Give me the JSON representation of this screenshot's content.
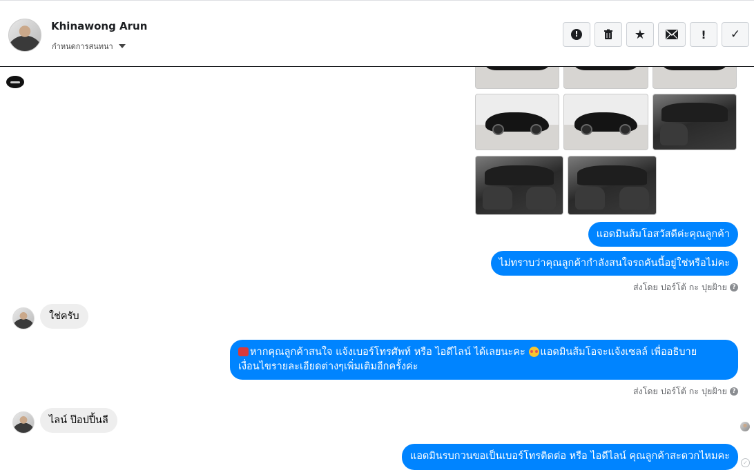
{
  "header": {
    "contact_name": "Khinawong Arun",
    "assign_label": "กำหนดการสนทนา",
    "actions": [
      {
        "icon": "alert-circle-icon",
        "glyph": "❗"
      },
      {
        "icon": "trash-icon",
        "glyph": "🗑"
      },
      {
        "icon": "star-icon",
        "glyph": "★"
      },
      {
        "icon": "envelope-icon",
        "glyph": "✉"
      },
      {
        "icon": "exclamation-icon",
        "glyph": "!"
      },
      {
        "icon": "check-icon",
        "glyph": "✓"
      }
    ]
  },
  "messages": {
    "m1": "แอดมินส้มโอสวัสดีค่ะคุณลูกค้า",
    "m2": "ไม่ทราบว่าคุณลูกค้ากำลังสนใจรถคันนี้อยู่ใช่หรือไม่คะ",
    "sent_by_1": "ส่งโดย ปอร์โต้ กะ ปุยฝ้าย",
    "reply1": "ใช่ครับ",
    "m3_line1_a": "หากคุณลูกค้าสนใจ แจ้งเบอร์โทรศัพท์ หรือ ไอดีไลน์  ได้เลยนะคะ",
    "m3_line1_b": "แอดมินส้มโอจะแจ้งเซลล์   เพื่ออธิบาย",
    "m3_line2": "เงื่อนไขรายละเอียดต่างๆเพิ่มเติมอีกครั้งค่ะ",
    "sent_by_2": "ส่งโดย ปอร์โต้ กะ ปุยฝ้าย",
    "reply2": "ไลน์ ป๊อปปี้นลี",
    "m4": "แอดมินรบกวนขอเป็นเบอร์โทรติดต่อ หรือ ไอดีไลน์ คุณลูกค้าสะดวกไหมคะ"
  },
  "colors": {
    "outgoing_bubble": "#0084ff",
    "incoming_bubble": "#eeeeee",
    "meta_text": "#65676b"
  }
}
